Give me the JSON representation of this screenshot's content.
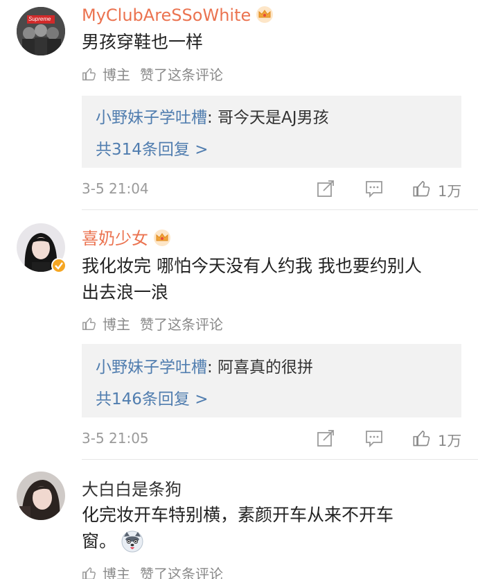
{
  "comments": [
    {
      "username": "MyClubAreSSoWhite",
      "text_lines": [
        "男孩穿鞋也一样"
      ],
      "liked_author": "博主",
      "liked_label": "赞了这条评论",
      "reply": {
        "user": "小野妹子学吐槽",
        "text": ": 哥今天是AJ男孩",
        "count": "共314条回复 >"
      },
      "time": "3-5 21:04",
      "likes": "1万",
      "avatar_text": "Supreme"
    },
    {
      "username": "喜奶少女",
      "text_lines": [
        "我化妆完 哪怕今天没有人约我 我也要约别人",
        "出去浪一浪"
      ],
      "liked_author": "博主",
      "liked_label": "赞了这条评论",
      "reply": {
        "user": "小野妹子学吐槽",
        "text": ": 阿喜真的很拼",
        "count": "共146条回复 >"
      },
      "time": "3-5 21:05",
      "likes": "1万"
    },
    {
      "username": "大白白是条狗",
      "text_lines": [
        "化完妆开车特别横，素颜开车从来不开车",
        "窗。"
      ],
      "liked_author": "博主",
      "liked_label": "赞了这条评论"
    }
  ],
  "colors": {
    "accent_orange": "#eb7350",
    "link_blue": "#507daf",
    "reply_bg": "#f2f2f2"
  },
  "icons": [
    "thumb-up-icon",
    "share-icon",
    "comment-icon",
    "crown-icon",
    "husky-emoji-icon"
  ]
}
